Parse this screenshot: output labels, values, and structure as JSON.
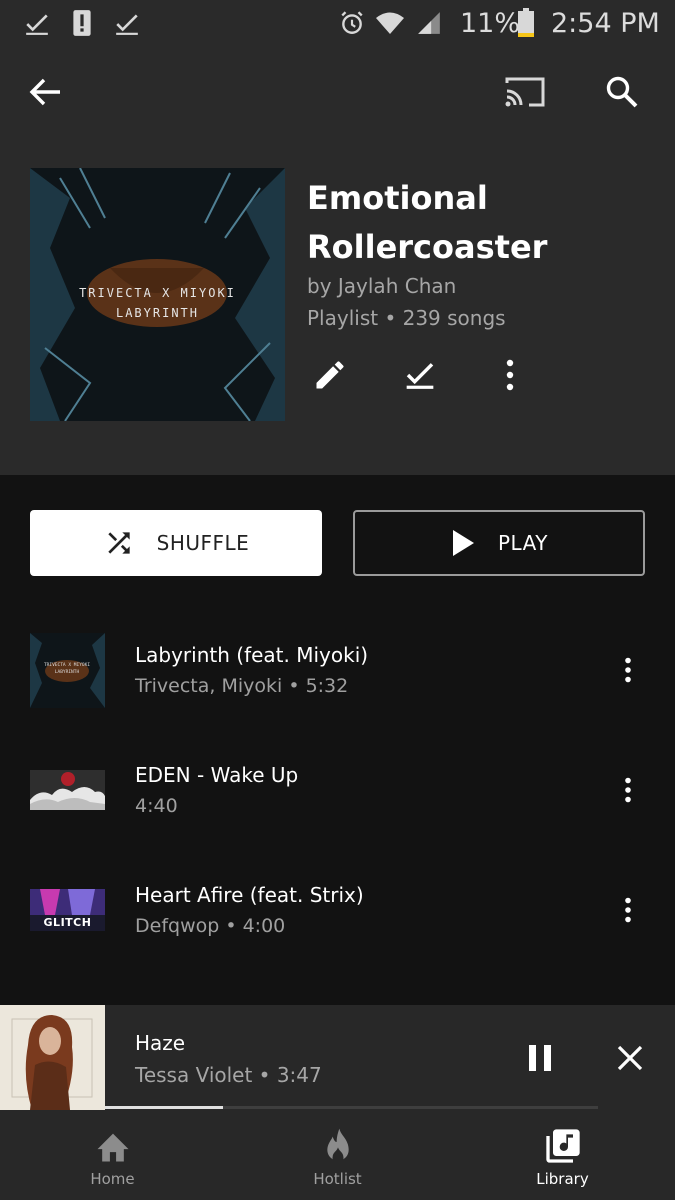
{
  "status_bar": {
    "battery": "11%",
    "time": "2:54 PM",
    "icons": [
      "check-icon",
      "alert-icon",
      "check-icon",
      "alarm-icon",
      "wifi-icon",
      "signal-icon",
      "battery-icon"
    ]
  },
  "header": {
    "icons": [
      "back-arrow-icon",
      "cast-icon",
      "search-icon"
    ]
  },
  "playlist": {
    "cover_text_line1": "TRIVECTA X MIYOKI",
    "cover_text_line2": "LABYRINTH",
    "title_line1": "Emotional",
    "title_line2": "Rollercoaster",
    "owner": "by Jaylah Chan",
    "meta": "Playlist • 239 songs",
    "actions": [
      "edit-icon",
      "download-check-icon",
      "more-vertical-icon"
    ]
  },
  "buttons": {
    "shuffle_label": "SHUFFLE",
    "play_label": "PLAY"
  },
  "tracks": [
    {
      "title": "Labyrinth (feat. Miyoki)",
      "subtitle": "Trivecta, Miyoki • 5:32"
    },
    {
      "title": "EDEN - Wake Up",
      "subtitle": "4:40"
    },
    {
      "title": "Heart Afire (feat. Strix)",
      "subtitle": "Defqwop • 4:00",
      "art_text": "GLITCH HOP"
    }
  ],
  "now_playing": {
    "title": "Haze",
    "subtitle": "Tessa Violet • 3:47",
    "progress_fraction": 0.24
  },
  "bottom_nav": [
    {
      "label": "Home",
      "icon": "home-icon",
      "active": false
    },
    {
      "label": "Hotlist",
      "icon": "flame-icon",
      "active": false
    },
    {
      "label": "Library",
      "icon": "library-music-icon",
      "active": true
    }
  ],
  "colors": {
    "background": "#121212",
    "header_bg": "#2a2a2a",
    "secondary_text": "#a6a6a6"
  }
}
